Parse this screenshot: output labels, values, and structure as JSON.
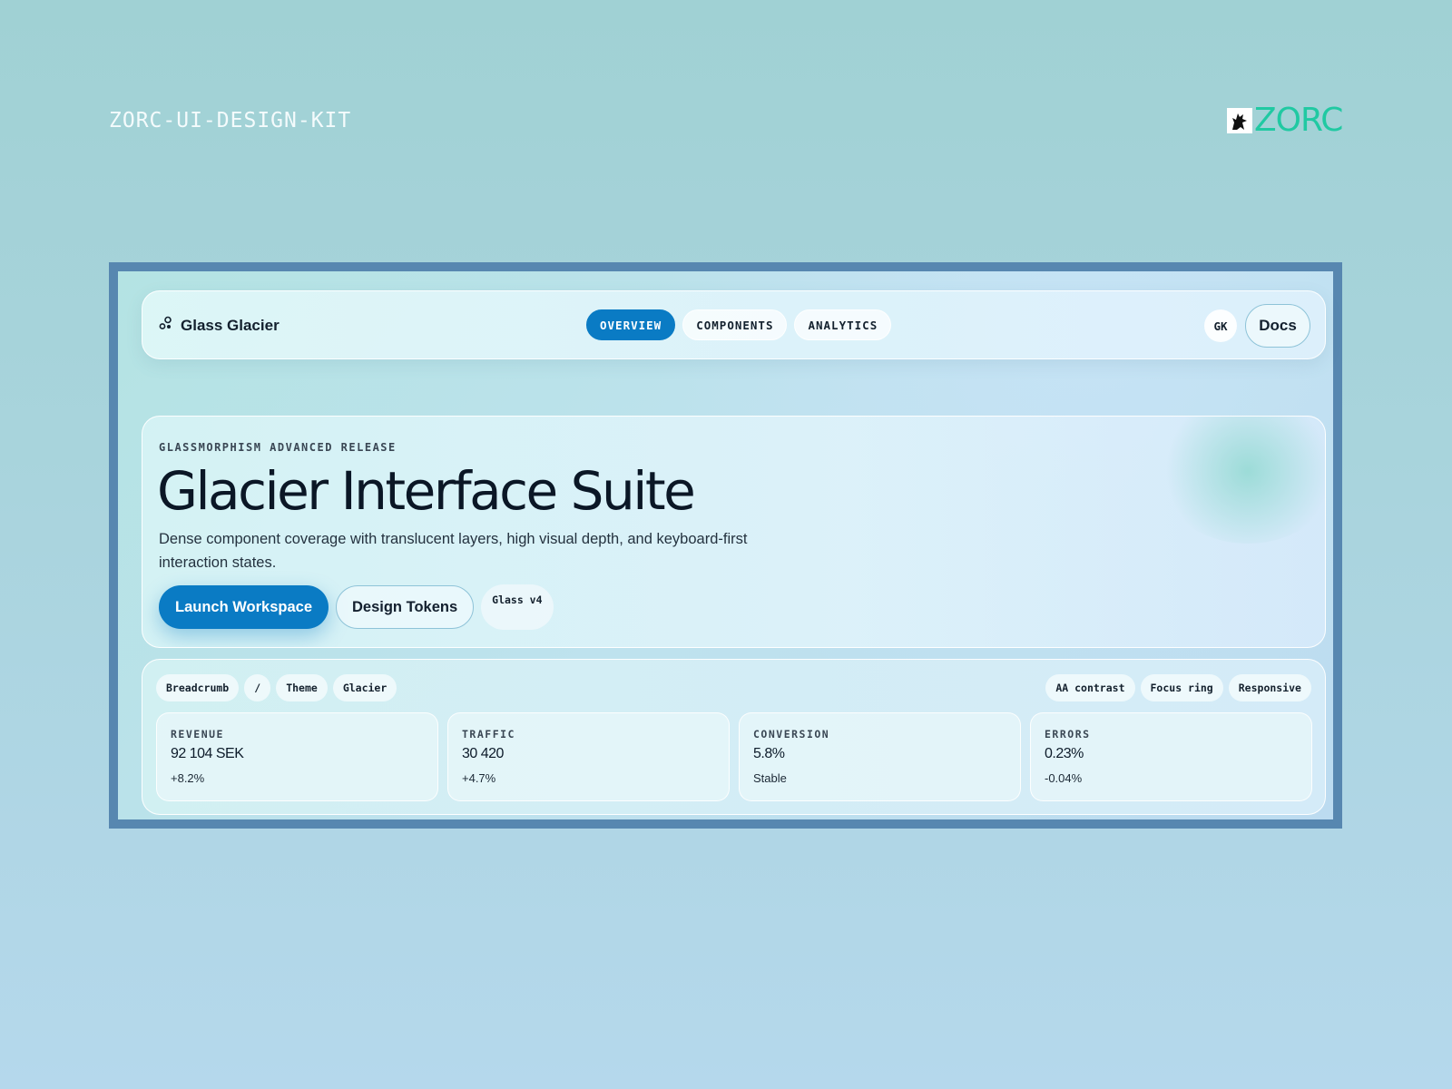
{
  "kit_title": "ZORC-UI-DESIGN-KIT",
  "brand": {
    "wordmark": "ZORC",
    "color": "#20c9a2"
  },
  "colors": {
    "accent": "#0a7bc4",
    "frame_border": "#5787b0"
  },
  "nav": {
    "brand_icon": "nodes-icon",
    "brand_name": "Glass Glacier",
    "tabs": [
      {
        "label": "OVERVIEW",
        "active": true
      },
      {
        "label": "COMPONENTS",
        "active": false
      },
      {
        "label": "ANALYTICS",
        "active": false
      }
    ],
    "avatar_initials": "GK",
    "docs_label": "Docs"
  },
  "hero": {
    "eyebrow": "GLASSMORPHISM ADVANCED RELEASE",
    "title": "Glacier Interface Suite",
    "description": "Dense component coverage with translucent layers, high visual depth, and keyboard-first interaction states.",
    "primary_action": "Launch Workspace",
    "secondary_action": "Design Tokens",
    "version_chip": "Glass v4"
  },
  "panel": {
    "breadcrumbs": [
      "Breadcrumb",
      "/",
      "Theme",
      "Glacier"
    ],
    "checks": [
      "AA contrast",
      "Focus ring",
      "Responsive"
    ],
    "metrics": [
      {
        "label": "REVENUE",
        "value": "92 104 SEK",
        "delta": "+8.2%"
      },
      {
        "label": "TRAFFIC",
        "value": "30 420",
        "delta": "+4.7%"
      },
      {
        "label": "CONVERSION",
        "value": "5.8%",
        "delta": "Stable"
      },
      {
        "label": "ERRORS",
        "value": "0.23%",
        "delta": "-0.04%"
      }
    ]
  }
}
